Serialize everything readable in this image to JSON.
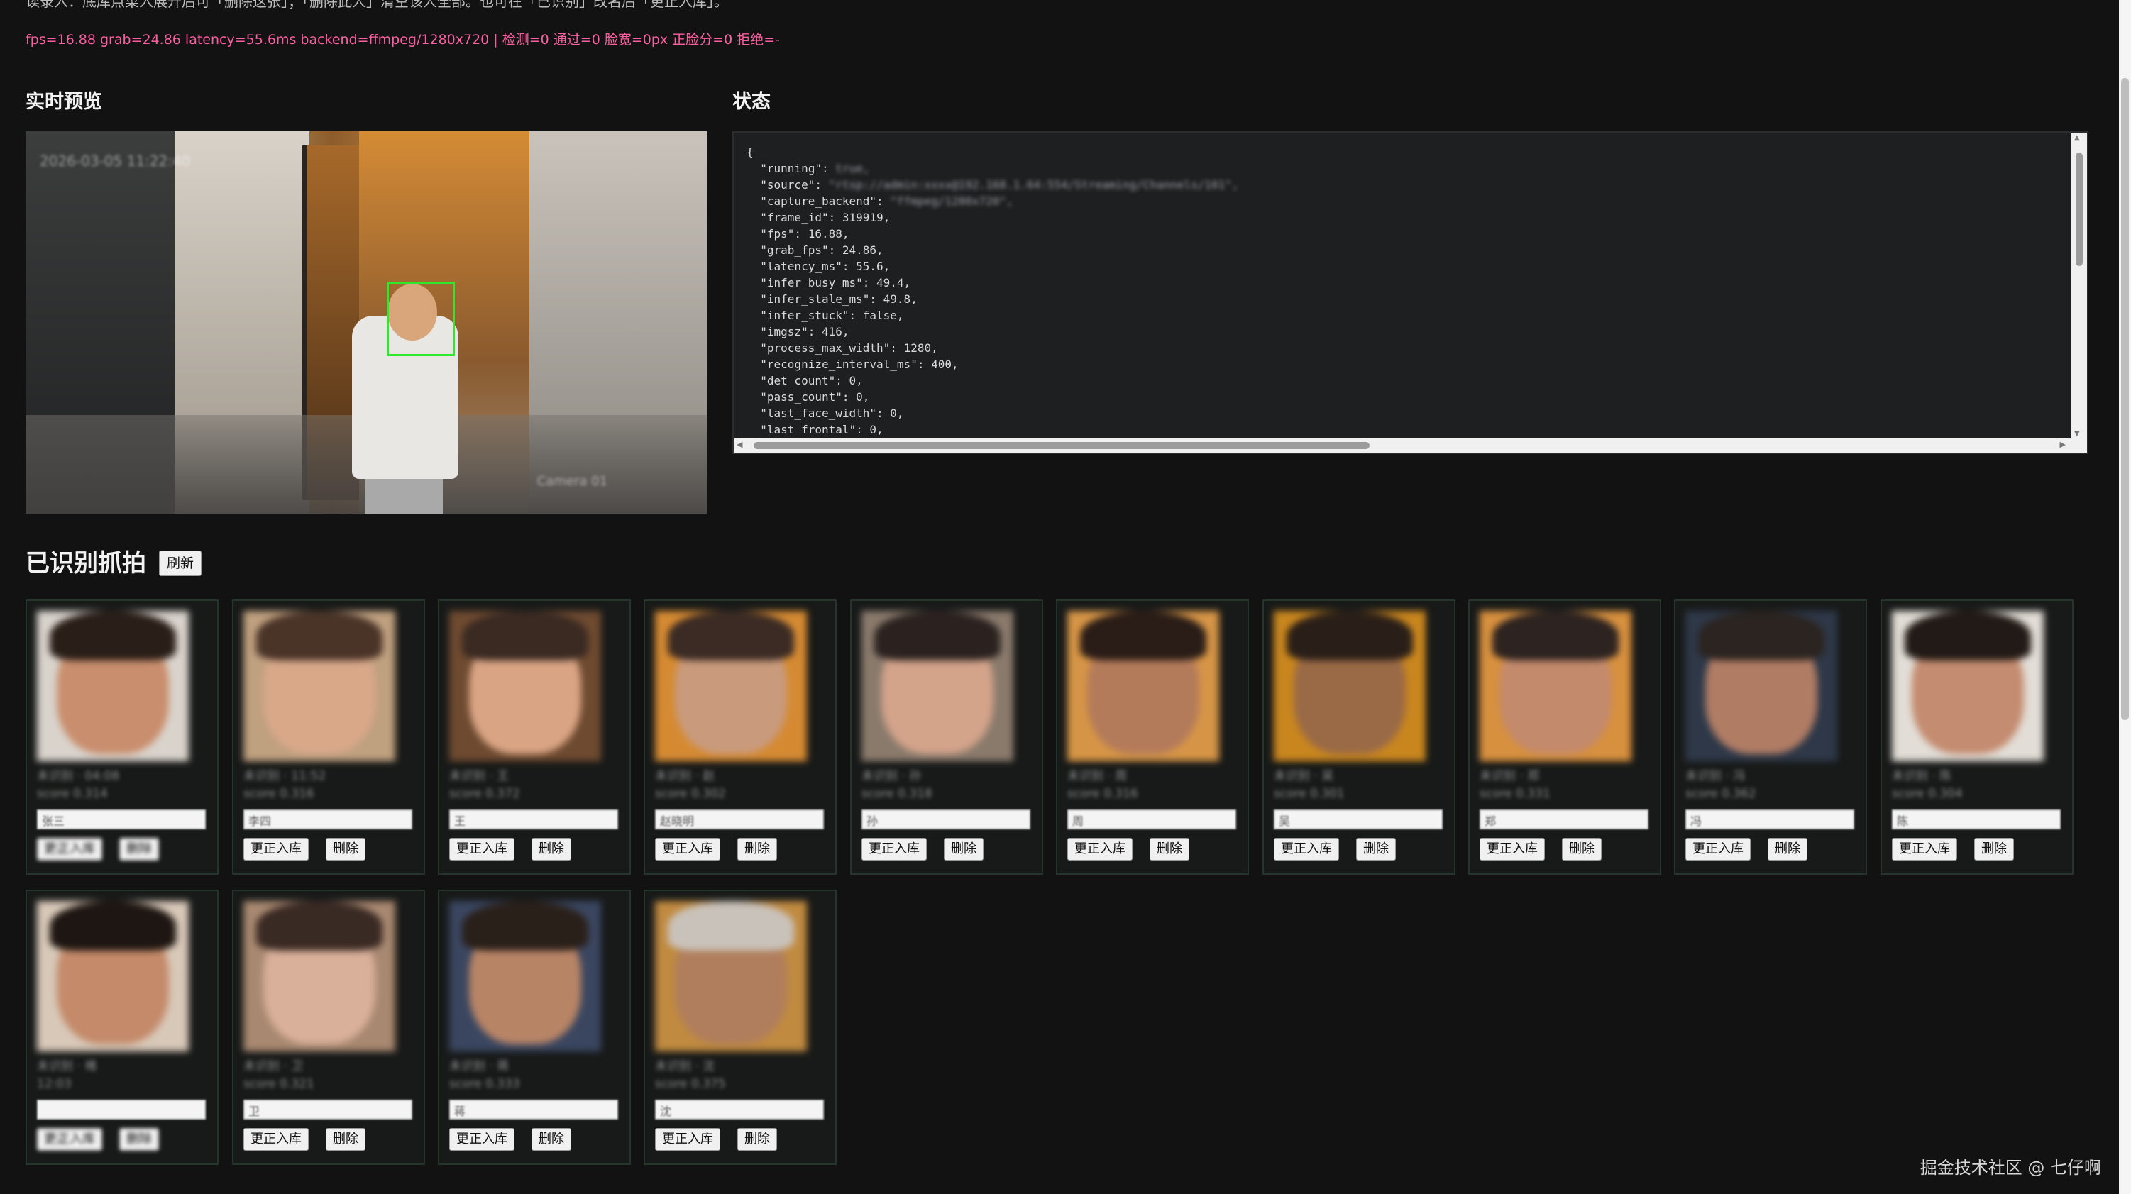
{
  "header": {
    "top_note": "读录入：底库点菜入展开后可「删除这张」；「删除此人」清空该人全部。也可在「已识别」改名后「更正入库」。",
    "metrics": "fps=16.88 grab=24.86 latency=55.6ms backend=ffmpeg/1280x720 | 检测=0 通过=0 脸宽=0px 正脸分=0 拒绝=-"
  },
  "preview": {
    "title": "实时预览",
    "overlay_text": "2026-03-05 11:22:40",
    "camera_label": "Camera 01",
    "face_box_color": "#2ee82e"
  },
  "status": {
    "title": "状态",
    "lines": [
      {
        "key": "{",
        "val": ""
      },
      {
        "key": "  \"running\": ",
        "val": "true,"
      },
      {
        "key": "  \"source\": ",
        "val": "\"rtsp://admin:xxxx@192.168.1.64:554/Streaming/Channels/101\","
      },
      {
        "key": "  \"capture_backend\": ",
        "val": "\"ffmpeg/1280x720\","
      },
      {
        "key": "  \"frame_id\": 319919,",
        "val": ""
      },
      {
        "key": "  \"fps\": 16.88,",
        "val": ""
      },
      {
        "key": "  \"grab_fps\": 24.86,",
        "val": ""
      },
      {
        "key": "  \"latency_ms\": 55.6,",
        "val": ""
      },
      {
        "key": "  \"infer_busy_ms\": 49.4,",
        "val": ""
      },
      {
        "key": "  \"infer_stale_ms\": 49.8,",
        "val": ""
      },
      {
        "key": "  \"infer_stuck\": false,",
        "val": ""
      },
      {
        "key": "  \"imgsz\": 416,",
        "val": ""
      },
      {
        "key": "  \"process_max_width\": 1280,",
        "val": ""
      },
      {
        "key": "  \"recognize_interval_ms\": 400,",
        "val": ""
      },
      {
        "key": "  \"det_count\": 0,",
        "val": ""
      },
      {
        "key": "  \"pass_count\": 0,",
        "val": ""
      },
      {
        "key": "  \"last_face_width\": 0,",
        "val": ""
      },
      {
        "key": "  \"last_frontal\": 0,",
        "val": ""
      }
    ]
  },
  "captures": {
    "title": "已识别抓拍",
    "refresh_label": "刷新",
    "correct_label": "更正入库",
    "delete_label": "删除",
    "items": [
      {
        "meta1": "未识别 · 04:08",
        "meta2": "score 0.314",
        "name": "张三",
        "skin": "#c98e6d",
        "hair": "#2a1e18",
        "bg": "#d9d3cc"
      },
      {
        "meta1": "未识别 · 11:52",
        "meta2": "score 0.316",
        "name": "李四",
        "skin": "#d8a889",
        "hair": "#4a3428",
        "bg": "#bfa07f"
      },
      {
        "meta1": "未识别 · 王",
        "meta2": "score 0.372",
        "name": "王",
        "skin": "#d9a484",
        "hair": "#3a2a22",
        "bg": "#6e4a30"
      },
      {
        "meta1": "未识别 · 赵",
        "meta2": "score 0.302",
        "name": "赵晓明",
        "skin": "#c99a7c",
        "hair": "#3b2b24",
        "bg": "#d58a32"
      },
      {
        "meta1": "未识别 · 孙",
        "meta2": "score 0.318",
        "name": "孙",
        "skin": "#d3a38a",
        "hair": "#2b2220",
        "bg": "#8a7a6c"
      },
      {
        "meta1": "未识别 · 周",
        "meta2": "score 0.316",
        "name": "周",
        "skin": "#b47b5a",
        "hair": "#2a1d17",
        "bg": "#d69546"
      },
      {
        "meta1": "未识别 · 吴",
        "meta2": "score 0.301",
        "name": "吴",
        "skin": "#9a6a46",
        "hair": "#2a1f18",
        "bg": "#c9861e"
      },
      {
        "meta1": "未识别 · 郑",
        "meta2": "score 0.331",
        "name": "郑",
        "skin": "#c48a6c",
        "hair": "#2d2320",
        "bg": "#d7903e"
      },
      {
        "meta1": "未识别 · 冯",
        "meta2": "score 0.362",
        "name": "冯",
        "skin": "#b07c64",
        "hair": "#2b2420",
        "bg": "#2e3848"
      },
      {
        "meta1": "未识别 · 陈",
        "meta2": "score 0.304",
        "name": "陈",
        "skin": "#c48c70",
        "hair": "#221a16",
        "bg": "#e2ddd6"
      },
      {
        "meta1": "未识别 · 褚",
        "meta2": "12:03",
        "name": "",
        "skin": "#c48a6a",
        "hair": "#1e1612",
        "bg": "#d8c8b8"
      },
      {
        "meta1": "未识别 · 卫",
        "meta2": "score 0.321",
        "name": "卫",
        "skin": "#d9b09a",
        "hair": "#3a2a24",
        "bg": "#a88870"
      },
      {
        "meta1": "未识别 · 蒋",
        "meta2": "score 0.333",
        "name": "蒋",
        "skin": "#b88466",
        "hair": "#2a201a",
        "bg": "#3a4660"
      },
      {
        "meta1": "未识别 · 沈",
        "meta2": "score 0.375",
        "name": "沈",
        "skin": "#b07e5c",
        "hair": "#c9c2ba",
        "bg": "#c08a40"
      }
    ]
  },
  "watermark": "掘金技术社区 @ 七仔啊"
}
